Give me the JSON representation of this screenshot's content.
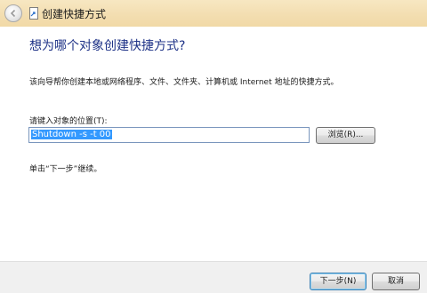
{
  "window": {
    "title": "创建快捷方式",
    "back_icon": "back-arrow-icon",
    "title_icon": "shortcut-icon"
  },
  "main": {
    "heading": "想为哪个对象创建快捷方式?",
    "description": "该向导帮你创建本地或网络程序、文件、文件夹、计算机或 Internet 地址的快捷方式。",
    "location_label": "请键入对象的位置(T):",
    "location_value": "Shutdown -s -t 00",
    "browse_label": "浏览(R)...",
    "hint": "单击“下一步”继续。"
  },
  "footer": {
    "next_label": "下一步(N)",
    "cancel_label": "取消"
  },
  "colors": {
    "titlebar": "#f3deb1",
    "heading": "#1e3287",
    "selection": "#3399ff",
    "footer": "#f0f0f0"
  }
}
